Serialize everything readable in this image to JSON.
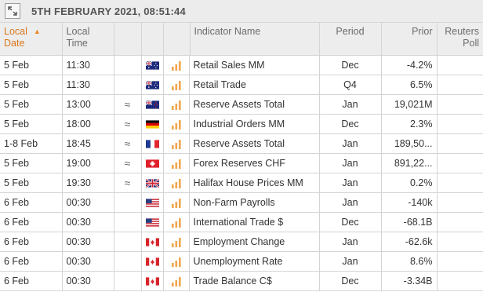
{
  "header": {
    "title": "5TH FEBRUARY 2021, 08:51:44",
    "expand_icon": "expand-icon"
  },
  "columns": {
    "local_date": "Local\nDate",
    "local_time": "Local\nTime",
    "indicator": "Indicator Name",
    "period": "Period",
    "prior": "Prior",
    "reuters": "Reuters\nPoll"
  },
  "rows": [
    {
      "date": "5 Feb",
      "time": "11:30",
      "approx": "",
      "country": "AU",
      "indicator": "Retail Sales MM",
      "period": "Dec",
      "prior": "-4.2%",
      "poll": ""
    },
    {
      "date": "5 Feb",
      "time": "11:30",
      "approx": "",
      "country": "AU",
      "indicator": "Retail Trade",
      "period": "Q4",
      "prior": "6.5%",
      "poll": ""
    },
    {
      "date": "5 Feb",
      "time": "13:00",
      "approx": "≈",
      "country": "NZ",
      "indicator": "Reserve Assets Total",
      "period": "Jan",
      "prior": "19,021M",
      "poll": ""
    },
    {
      "date": "5 Feb",
      "time": "18:00",
      "approx": "≈",
      "country": "DE",
      "indicator": "Industrial Orders MM",
      "period": "Dec",
      "prior": "2.3%",
      "poll": ""
    },
    {
      "date": "1-8 Feb",
      "time": "18:45",
      "approx": "≈",
      "country": "FR",
      "indicator": "Reserve Assets Total",
      "period": "Jan",
      "prior": "189,50...",
      "poll": ""
    },
    {
      "date": "5 Feb",
      "time": "19:00",
      "approx": "≈",
      "country": "CH",
      "indicator": "Forex Reserves CHF",
      "period": "Jan",
      "prior": "891,22...",
      "poll": ""
    },
    {
      "date": "5 Feb",
      "time": "19:30",
      "approx": "≈",
      "country": "GB",
      "indicator": "Halifax House Prices MM",
      "period": "Jan",
      "prior": "0.2%",
      "poll": ""
    },
    {
      "date": "6 Feb",
      "time": "00:30",
      "approx": "",
      "country": "US",
      "indicator": "Non-Farm Payrolls",
      "period": "Jan",
      "prior": "-140k",
      "poll": ""
    },
    {
      "date": "6 Feb",
      "time": "00:30",
      "approx": "",
      "country": "US",
      "indicator": "International Trade $",
      "period": "Dec",
      "prior": "-68.1B",
      "poll": ""
    },
    {
      "date": "6 Feb",
      "time": "00:30",
      "approx": "",
      "country": "CA",
      "indicator": "Employment Change",
      "period": "Jan",
      "prior": "-62.6k",
      "poll": ""
    },
    {
      "date": "6 Feb",
      "time": "00:30",
      "approx": "",
      "country": "CA",
      "indicator": "Unemployment Rate",
      "period": "Jan",
      "prior": "8.6%",
      "poll": ""
    },
    {
      "date": "6 Feb",
      "time": "00:30",
      "approx": "",
      "country": "CA",
      "indicator": "Trade Balance C$",
      "period": "Dec",
      "prior": "-3.34B",
      "poll": ""
    }
  ],
  "colors": {
    "accent": "#e98a25",
    "header_bg": "#ededed",
    "grid": "#d4d4d4"
  }
}
